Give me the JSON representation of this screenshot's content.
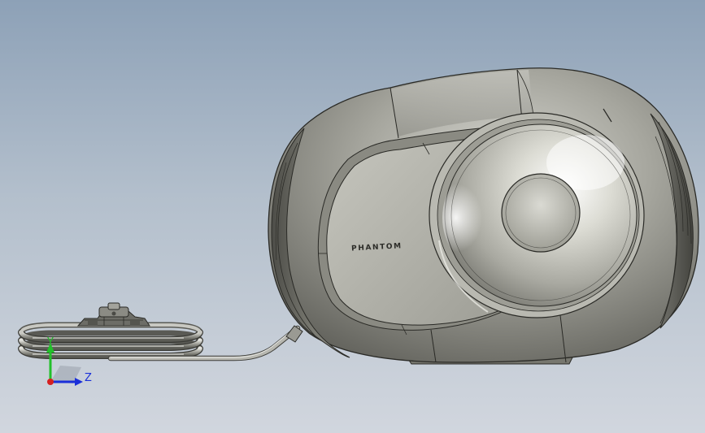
{
  "model": {
    "brand_text": "PHANTOM"
  },
  "triad": {
    "y_label": "Y",
    "z_label": "Z",
    "y_color": "#22c02a",
    "z_color": "#1a2fd9",
    "x_color": "#d62020"
  },
  "colors": {
    "background_top": "#8da1b7",
    "background_bottom": "#d1d6de",
    "body_shell": "#8c8c84",
    "body_shell_light": "#d6d6d0",
    "edge_line": "#2a2a26"
  }
}
